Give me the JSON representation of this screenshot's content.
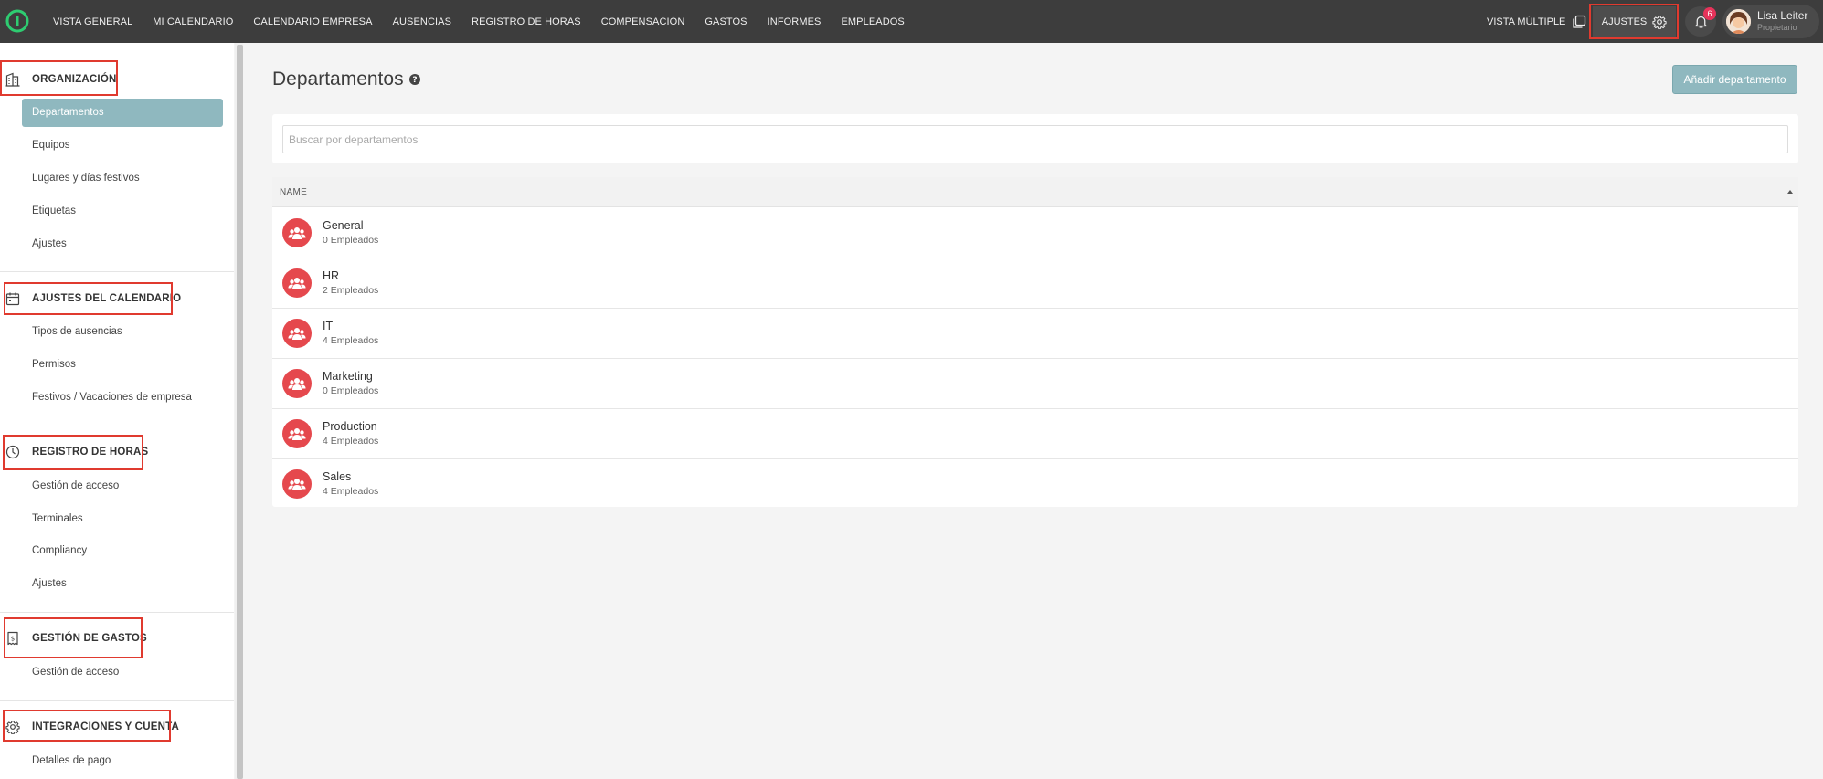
{
  "topnav": {
    "items": [
      "VISTA GENERAL",
      "MI CALENDARIO",
      "CALENDARIO EMPRESA",
      "AUSENCIAS",
      "REGISTRO DE HORAS",
      "COMPENSACIÓN",
      "GASTOS",
      "INFORMES",
      "EMPLEADOS"
    ],
    "vista_multiple": "VISTA MÚLTIPLE",
    "ajustes": "AJUSTES",
    "notification_count": "6",
    "user_name": "Lisa Leiter",
    "user_role": "Propietario"
  },
  "sidebar": {
    "sections": [
      {
        "title": "ORGANIZACIÓN",
        "icon": "building-icon",
        "items": [
          "Departamentos",
          "Equipos",
          "Lugares y días festivos",
          "Etiquetas",
          "Ajustes"
        ]
      },
      {
        "title": "AJUSTES DEL CALENDARIO",
        "icon": "calendar-icon",
        "items": [
          "Tipos de ausencias",
          "Permisos",
          "Festivos / Vacaciones de empresa"
        ]
      },
      {
        "title": "REGISTRO DE HORAS",
        "icon": "clock-icon",
        "items": [
          "Gestión de acceso",
          "Terminales",
          "Compliancy",
          "Ajustes"
        ]
      },
      {
        "title": "GESTIÓN DE GASTOS",
        "icon": "receipt-icon",
        "items": [
          "Gestión de acceso"
        ]
      },
      {
        "title": "INTEGRACIONES Y CUENTA",
        "icon": "gear-icon",
        "items": [
          "Detalles de pago"
        ]
      }
    ]
  },
  "main": {
    "title": "Departamentos",
    "add_button": "Añadir departamento",
    "search_placeholder": "Buscar por departamentos",
    "table": {
      "header": "NAME",
      "rows": [
        {
          "name": "General",
          "count": "0 Empleados"
        },
        {
          "name": "HR",
          "count": "2 Empleados"
        },
        {
          "name": "IT",
          "count": "4 Empleados"
        },
        {
          "name": "Marketing",
          "count": "0 Empleados"
        },
        {
          "name": "Production",
          "count": "4 Empleados"
        },
        {
          "name": "Sales",
          "count": "4 Empleados"
        }
      ]
    }
  },
  "colors": {
    "accent": "#8fb8bf",
    "topbar": "#3d3d3d",
    "dept_icon": "#e5484d",
    "highlight": "#e03a2f",
    "badge": "#e6335a"
  }
}
